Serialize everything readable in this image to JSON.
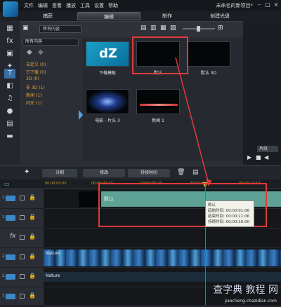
{
  "menubar": {
    "items": [
      "文件",
      "编辑",
      "查看",
      "播放",
      "工具",
      "设置",
      "帮助"
    ],
    "project_title": "未命名的新项目*"
  },
  "modes": {
    "capture": "捕获",
    "edit": "编辑",
    "share": "制作",
    "disc": "创建光盘"
  },
  "library": {
    "dropdown": "所有内容",
    "category_header": "所有内容",
    "categories": [
      "自定义 (0)",
      "已下载 (0)",
      "3D (0)",
      "非 3D (1)",
      "新闻 (1)",
      "闪光 (1)"
    ],
    "items": [
      {
        "label": "下载模板",
        "thumb_text": "dZ"
      },
      {
        "label": "默认"
      },
      {
        "label": "默认 3D"
      },
      {
        "label": "电影 - 片头 3"
      },
      {
        "label": "新闻 1"
      }
    ]
  },
  "preview": {
    "clip_label": "片段"
  },
  "edit_toolbar": {
    "split": "分割",
    "modify": "修改",
    "duration": "持续时间"
  },
  "timeline": {
    "ruler_times": [
      "00:00:00:00",
      "00:00:03:10",
      "00:00:06:20",
      "00:00:10:00",
      "00:00:13:10"
    ],
    "tracks": [
      "1.",
      "1.",
      "fx",
      "2.",
      "2.",
      "3."
    ],
    "title_clip_label": "默认",
    "video_label": "Nature",
    "audio_label": "Nature",
    "tooltip": {
      "name": "默认",
      "start": "起始时间: 00:00:01:06",
      "end": "结束时间: 00:00:11:06",
      "duration": "持续时间: 00:00:10:00"
    }
  },
  "watermark": {
    "text": "查字典 教程 网",
    "url": "jiaocheng.chazidian.com"
  },
  "colors": {
    "accent": "#3b6fa6",
    "highlight": "#e03a3a",
    "title_clip": "#5ea195"
  }
}
